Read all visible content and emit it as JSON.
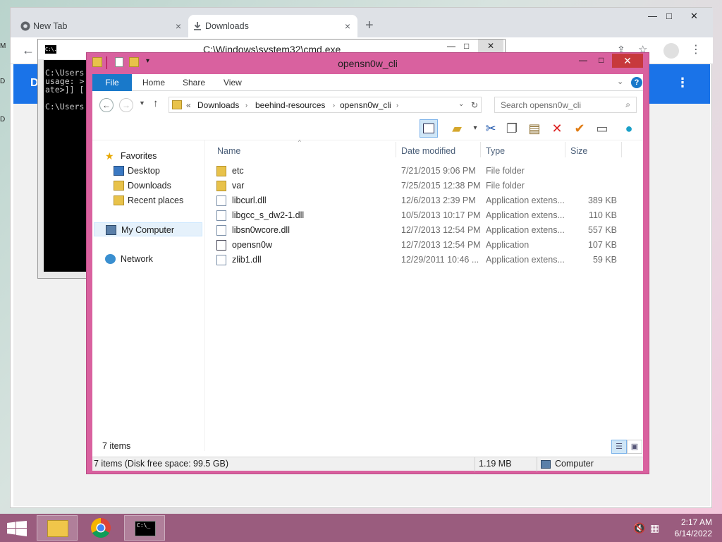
{
  "desktop": {
    "labels": [
      "M",
      "D",
      "D"
    ]
  },
  "chrome": {
    "tabs": [
      {
        "label": "New Tab",
        "icon": "chrome-icon"
      },
      {
        "label": "Downloads",
        "icon": "download-icon"
      }
    ],
    "close_glyph": "×",
    "new_tab_glyph": "+",
    "page_header_letter": "D",
    "page_menu_glyph": "⋮"
  },
  "cmd": {
    "title": "C:\\Windows\\system32\\cmd.exe",
    "icon_text": "C:\\.",
    "lines": [
      "C:\\Users",
      "usage: >",
      "ate>]] [",
      "",
      "C:\\Users"
    ]
  },
  "explorer": {
    "title": "opensn0w_cli",
    "ribbon_tabs": [
      "File",
      "Home",
      "Share",
      "View"
    ],
    "breadcrumb": [
      "«",
      "Downloads",
      "beehind-resources",
      "opensn0w_cli"
    ],
    "search_placeholder": "Search opensn0w_cli",
    "nav": {
      "favorites": "Favorites",
      "desktop": "Desktop",
      "downloads": "Downloads",
      "recent": "Recent places",
      "my_computer": "My Computer",
      "network": "Network"
    },
    "columns": {
      "name": "Name",
      "date": "Date modified",
      "type": "Type",
      "size": "Size"
    },
    "files": [
      {
        "name": "etc",
        "date": "7/21/2015 9:06 PM",
        "type": "File folder",
        "size": "",
        "kind": "folder"
      },
      {
        "name": "var",
        "date": "7/25/2015 12:38 PM",
        "type": "File folder",
        "size": "",
        "kind": "folder"
      },
      {
        "name": "libcurl.dll",
        "date": "12/6/2013 2:39 PM",
        "type": "Application extens...",
        "size": "389 KB",
        "kind": "dll"
      },
      {
        "name": "libgcc_s_dw2-1.dll",
        "date": "10/5/2013 10:17 PM",
        "type": "Application extens...",
        "size": "110 KB",
        "kind": "dll"
      },
      {
        "name": "libsn0wcore.dll",
        "date": "12/7/2013 12:54 PM",
        "type": "Application extens...",
        "size": "557 KB",
        "kind": "dll"
      },
      {
        "name": "opensn0w",
        "date": "12/7/2013 12:54 PM",
        "type": "Application",
        "size": "107 KB",
        "kind": "exe"
      },
      {
        "name": "zlib1.dll",
        "date": "12/29/2011 10:46 ...",
        "type": "Application extens...",
        "size": "59 KB",
        "kind": "dll"
      }
    ],
    "item_count": "7 items",
    "status": {
      "left": "7 items (Disk free space: 99.5 GB)",
      "size": "1.19 MB",
      "location": "Computer"
    }
  },
  "taskbar": {
    "time": "2:17 AM",
    "date": "6/14/2022",
    "cmd_icon_text": "C:\\_"
  },
  "colors": {
    "explorer_frame": "#d9619f",
    "taskbar": "#9a5c7e",
    "chrome_blue": "#1a73e8",
    "file_tab": "#1979ca"
  }
}
